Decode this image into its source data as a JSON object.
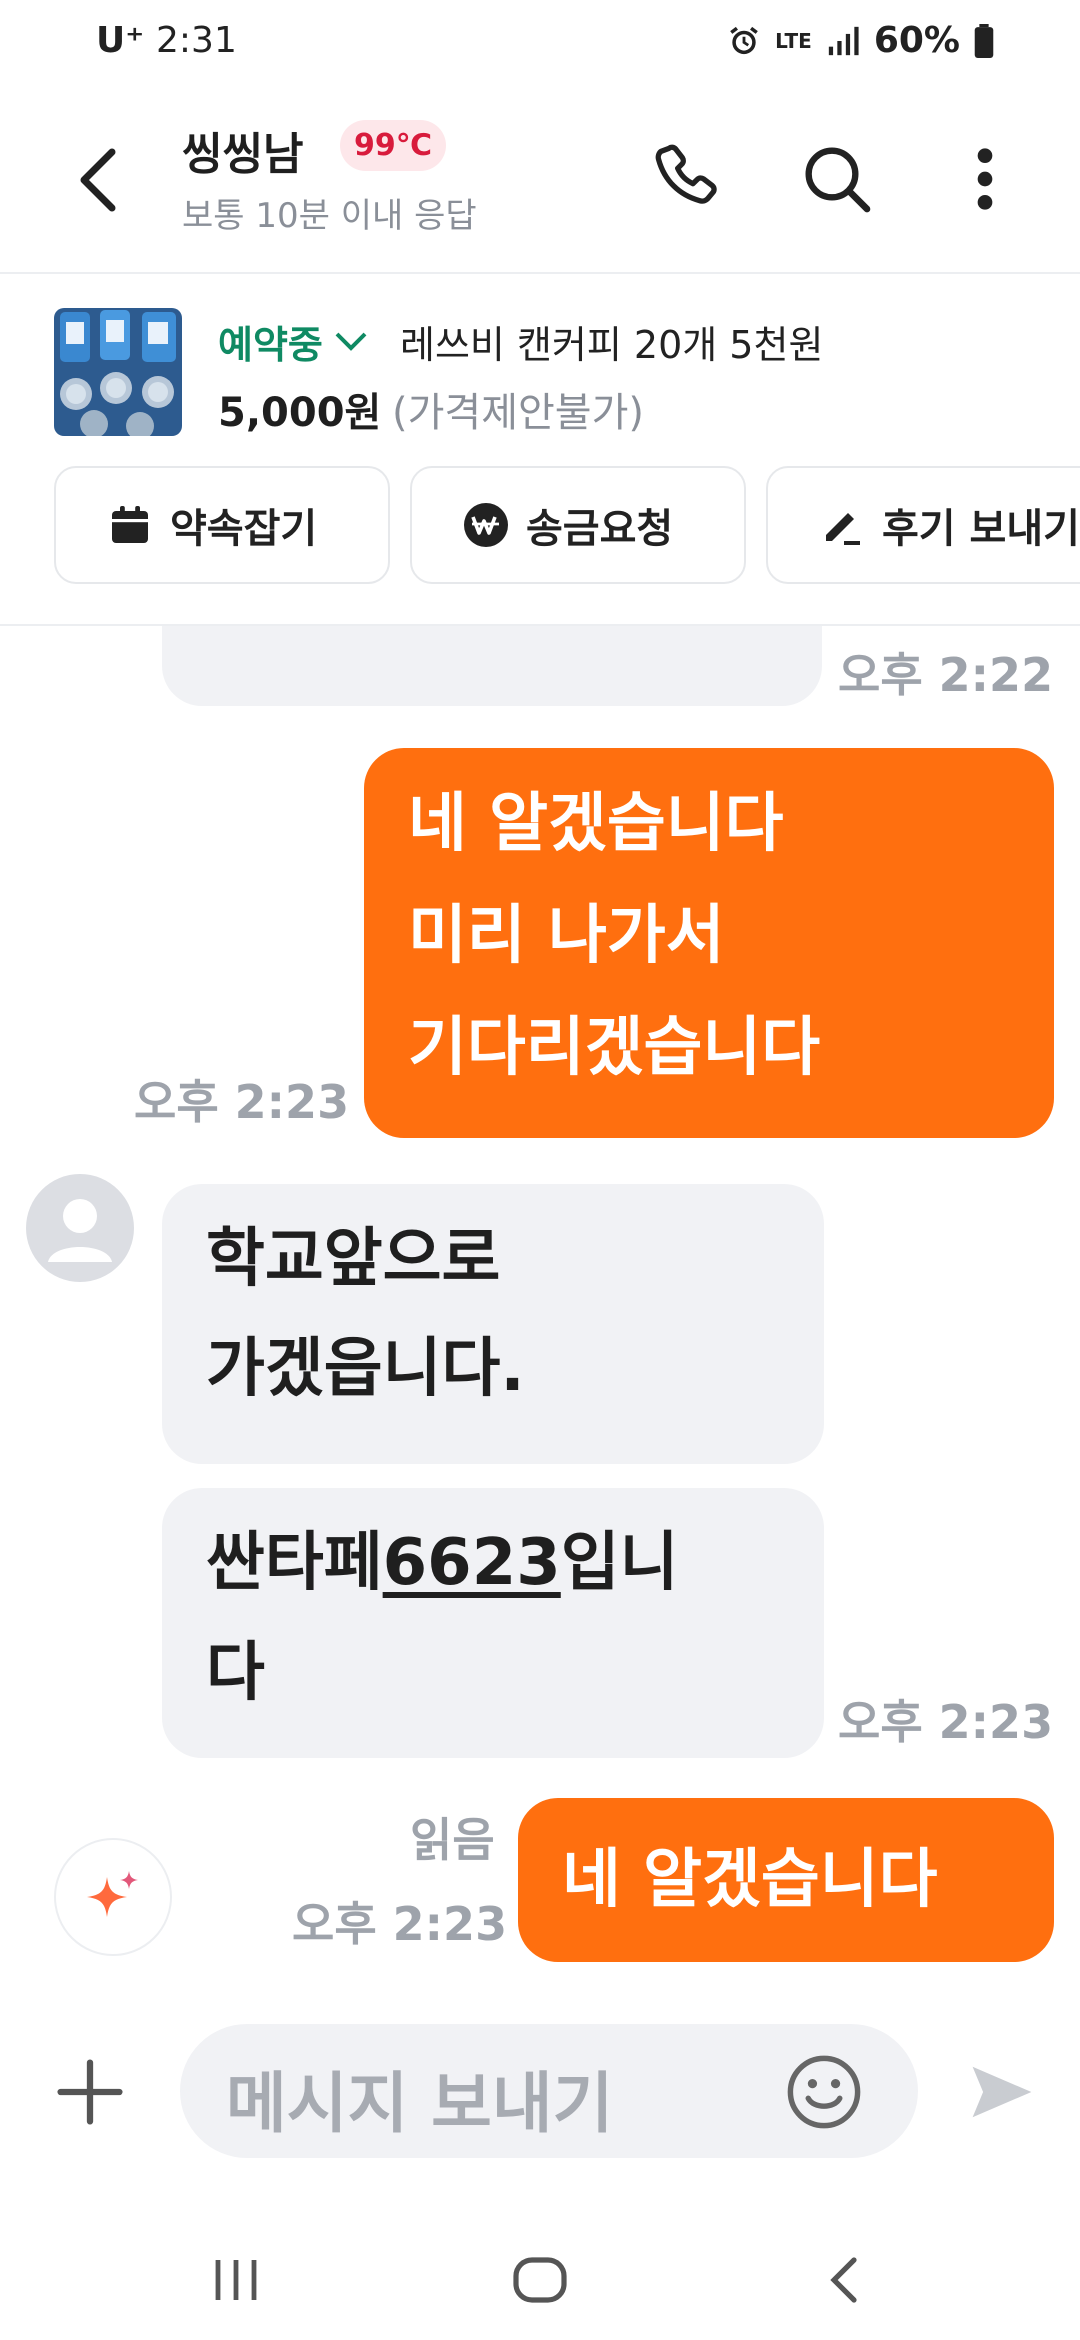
{
  "status_bar": {
    "carrier": "U⁺",
    "time": "2:31",
    "network": "LTE",
    "battery": "60%"
  },
  "header": {
    "name": "씽씽남",
    "temperature": "99℃",
    "response": "보통 10분 이내 응답",
    "icons": [
      "back-icon",
      "phone-icon",
      "search-icon",
      "more-icon"
    ]
  },
  "product": {
    "status": "예약중",
    "title": "레쓰비 캔커피 20개 5천원",
    "price": "5,000원",
    "negotiation": "(가격제안불가)"
  },
  "actions": {
    "appointment": "약속잡기",
    "money": "송금요청",
    "review": "후기 보내기"
  },
  "messages": {
    "partial_in_time": "오후 2:22",
    "out1_lines": [
      "네 알겠습니다",
      "미리 나가서",
      "기다리겠습니다"
    ],
    "out1_time": "오후 2:23",
    "in1_lines": [
      "학교앞으로",
      "가겠읍니다."
    ],
    "in2_prefix": "싼타페",
    "in2_plate": "6623",
    "in2_suffix_line1": "입니",
    "in2_line2": "다",
    "in2_time": "오후 2:23",
    "read": "읽음",
    "out2_time": "오후 2:23",
    "out2": "네 알겠습니다"
  },
  "composer": {
    "placeholder": "메시지 보내기"
  },
  "colors": {
    "accent": "#ff6f0f",
    "reserved_green": "#0f8a63",
    "temp_red": "#d81b3c"
  }
}
